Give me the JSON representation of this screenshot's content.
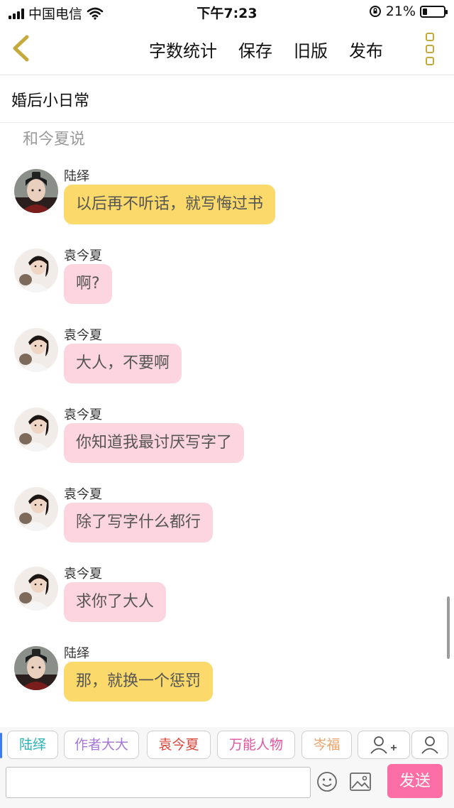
{
  "status_bar": {
    "carrier": "中国电信",
    "time": "下午7:23",
    "battery_percent": "21%",
    "battery_level": 0.21,
    "icons": [
      "signal-icon",
      "wifi-icon",
      "orientation-lock-icon",
      "battery-icon"
    ]
  },
  "nav": {
    "back_icon": "chevron-left-icon",
    "actions": [
      "字数统计",
      "保存",
      "旧版",
      "发布"
    ],
    "more_icon": "more-vertical-icon",
    "accent_color": "#c4a93c"
  },
  "document": {
    "title": "婚后小日常",
    "narration": "和今夏说"
  },
  "messages": [
    {
      "sender": "陆绎",
      "text": "以后再不听话，就写悔过书",
      "style": "yellow"
    },
    {
      "sender": "袁今夏",
      "text": "啊?",
      "style": "pink"
    },
    {
      "sender": "袁今夏",
      "text": "大人，不要啊",
      "style": "pink"
    },
    {
      "sender": "袁今夏",
      "text": "你知道我最讨厌写字了",
      "style": "pink"
    },
    {
      "sender": "袁今夏",
      "text": "除了写字什么都行",
      "style": "pink"
    },
    {
      "sender": "袁今夏",
      "text": "求你了大人",
      "style": "pink"
    },
    {
      "sender": "陆绎",
      "text": "那，就换一个惩罚",
      "style": "yellow"
    }
  ],
  "characters": [
    {
      "name": "陆绎",
      "color": "#2bb3b3"
    },
    {
      "name": "作者大大",
      "color": "#a678d6"
    },
    {
      "name": "袁今夏",
      "color": "#d9443b"
    },
    {
      "name": "万能人物",
      "color": "#e0569f"
    },
    {
      "name": "岑福",
      "color": "#eaa36b"
    }
  ],
  "character_bar_icons": [
    "add-character-icon",
    "character-icon"
  ],
  "input": {
    "placeholder": "",
    "emoji_icon": "emoji-icon",
    "image_icon": "image-icon",
    "send_label": "发送",
    "send_color": "#fb6fa6"
  },
  "colors": {
    "bubble_yellow": "#fbd96a",
    "bubble_pink": "#fdd5e0"
  }
}
